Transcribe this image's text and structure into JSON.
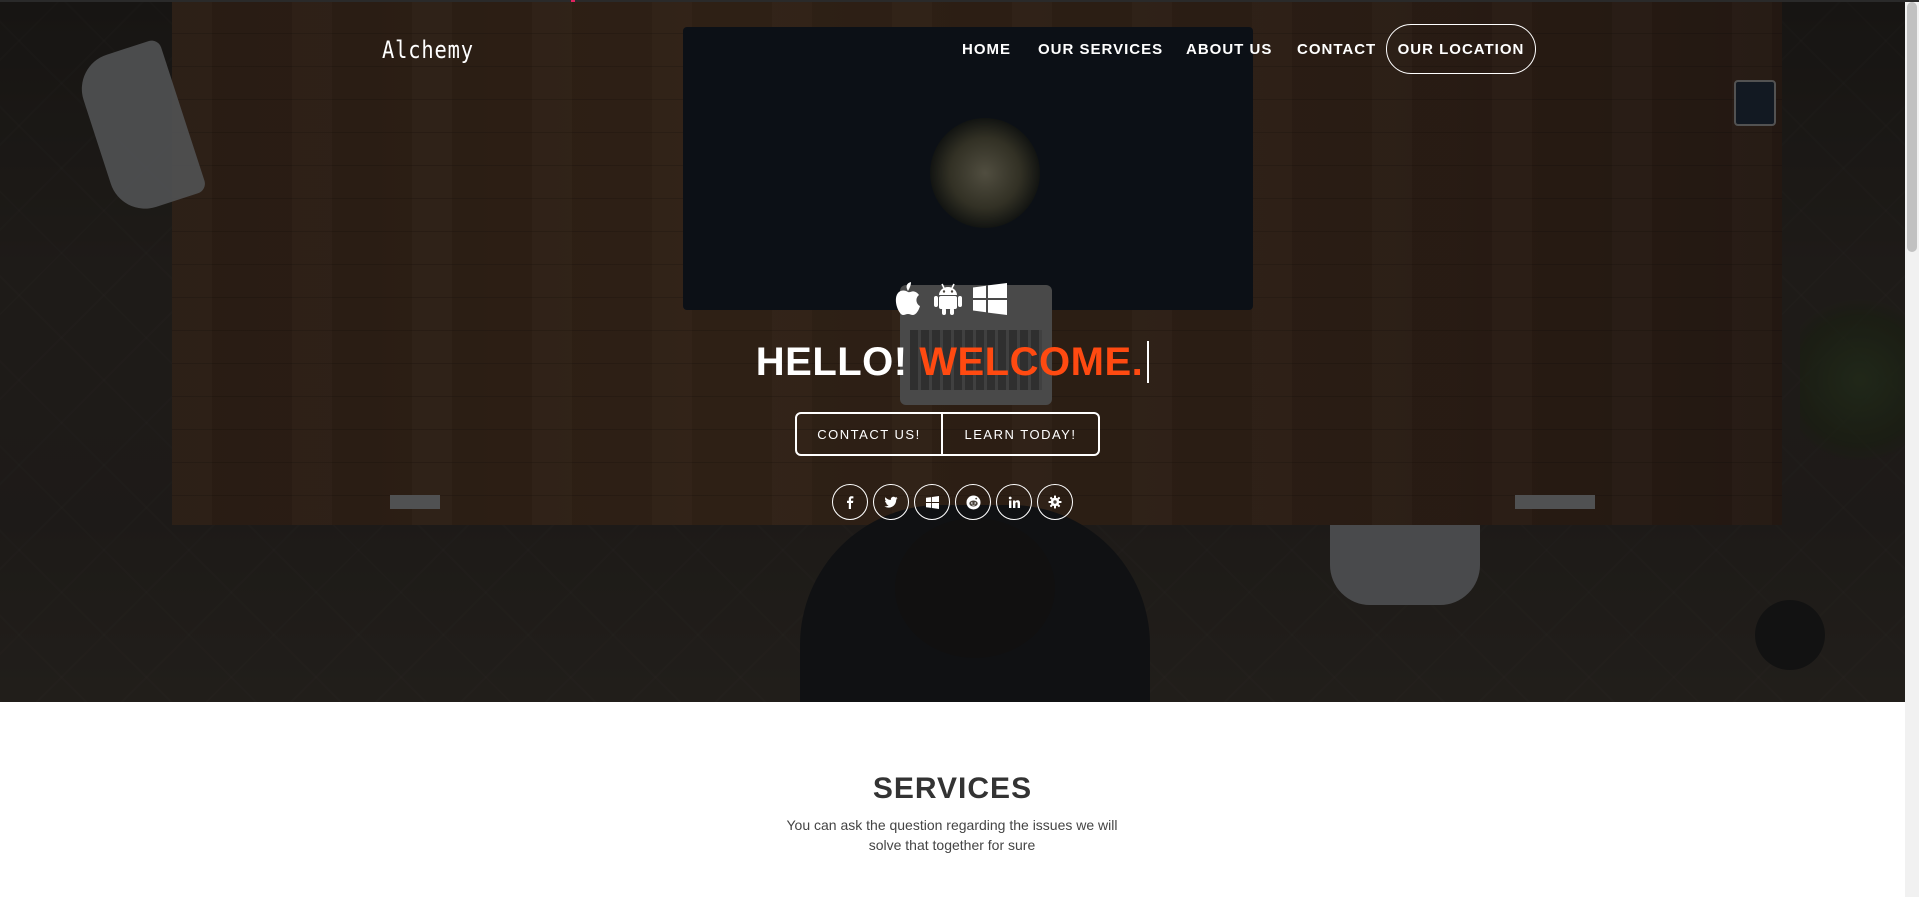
{
  "brand": {
    "name": "Alchemy"
  },
  "nav": {
    "items": [
      {
        "label": "HOME"
      },
      {
        "label": "OUR SERVICES"
      },
      {
        "label": "ABOUT US"
      },
      {
        "label": "CONTACT"
      }
    ],
    "cta_label": "OUR LOCATION"
  },
  "hero": {
    "platform_icons": [
      "apple-icon",
      "android-icon",
      "windows-icon"
    ],
    "headline_prefix": "HELLO!",
    "headline_accent": "WELCOME.",
    "buttons": [
      {
        "label": "CONTACT US!"
      },
      {
        "label": "LEARN TODAY!"
      }
    ],
    "social_icons": [
      "facebook-icon",
      "twitter-icon",
      "windows-icon",
      "reddit-icon",
      "linkedin-icon",
      "gear-icon"
    ]
  },
  "services": {
    "title": "SERVICES",
    "subtitle": "You can ask the question regarding the issues we will solve that together for sure"
  },
  "colors": {
    "accent": "#ff4a11",
    "overlay": "#000000",
    "text_on_dark": "#ffffff"
  }
}
